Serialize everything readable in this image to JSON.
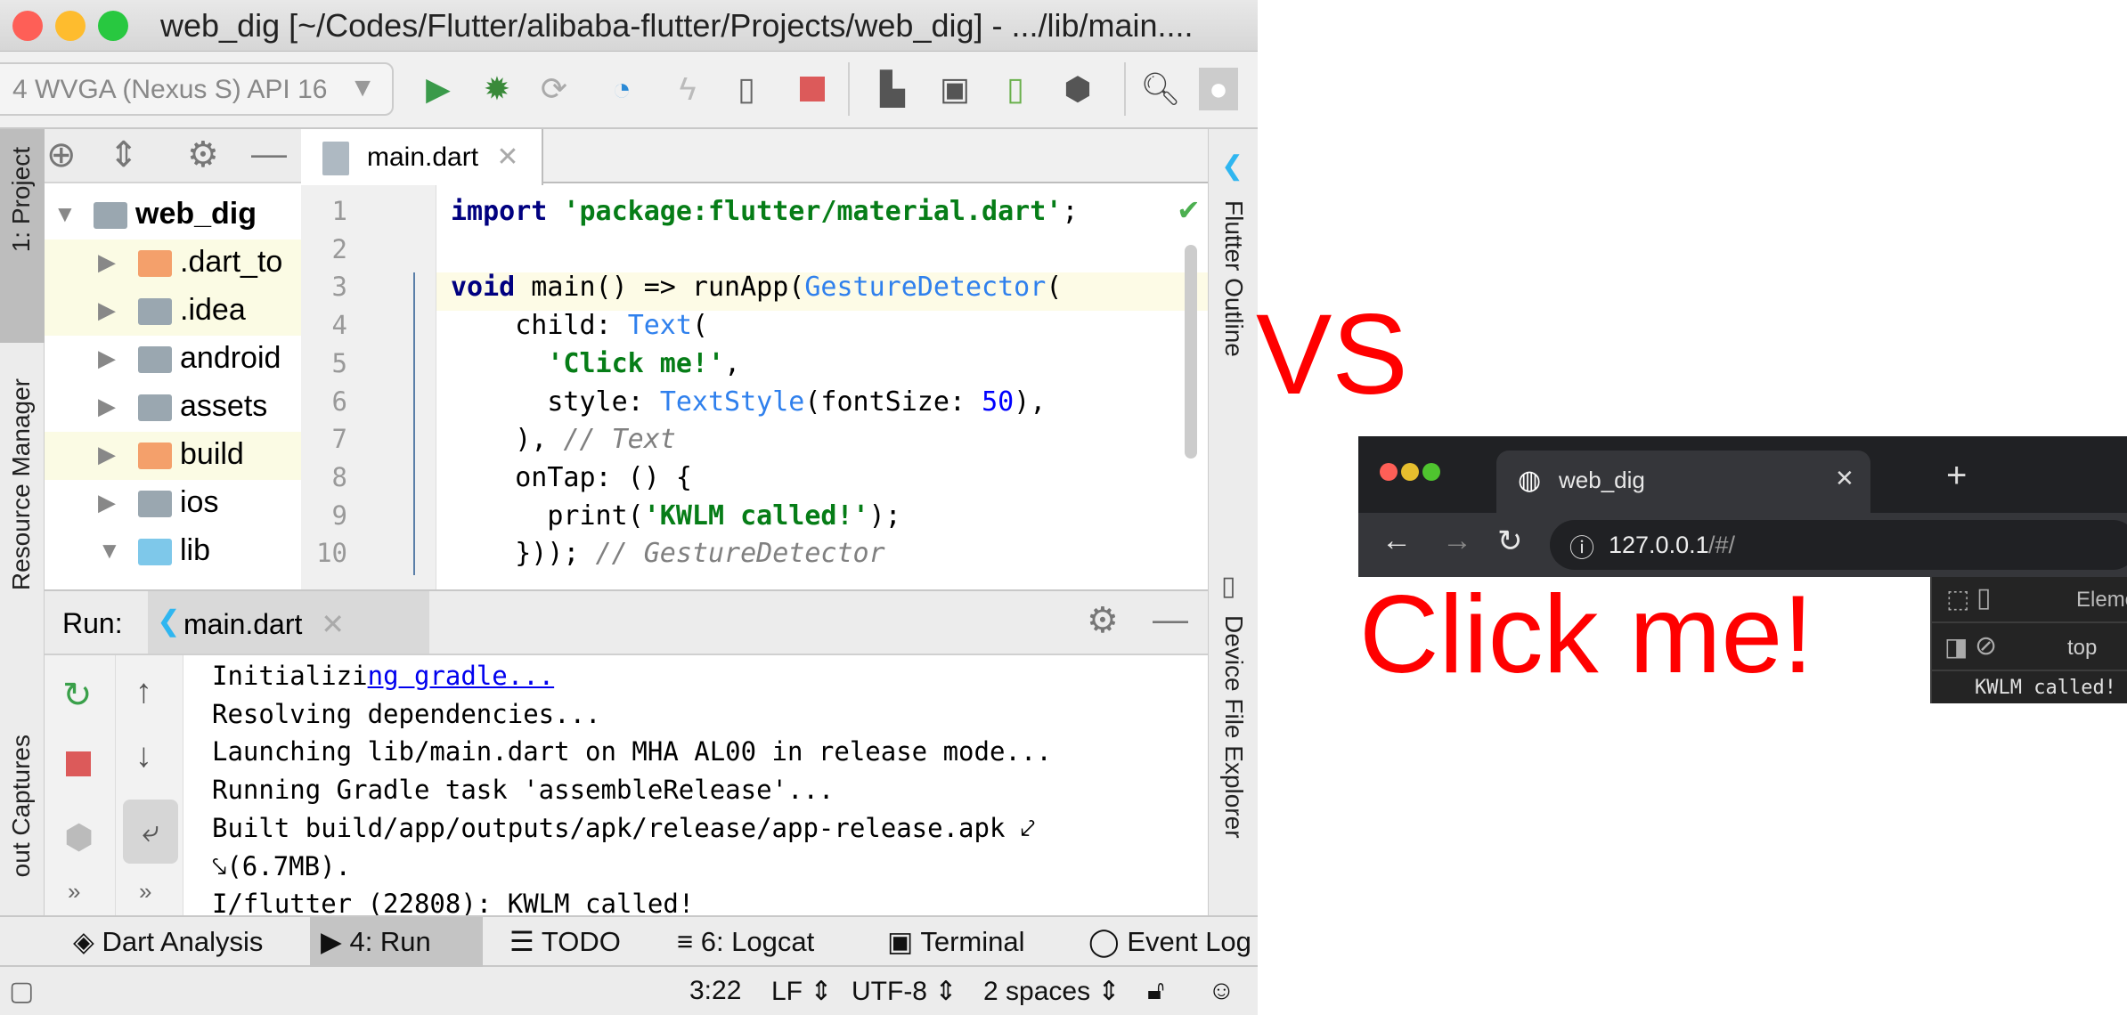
{
  "window": {
    "title": "web_dig [~/Codes/Flutter/alibaba-flutter/Projects/web_dig] - .../lib/main...."
  },
  "toolbar": {
    "device": "4  WVGA (Nexus S) API 16",
    "icons": [
      "run-icon",
      "debug-icon",
      "attach-debugger-icon",
      "profile-icon",
      "hot-reload-icon",
      "flutter-inspector-icon",
      "stop-icon",
      "project-structure-icon",
      "avd-manager-icon",
      "sdk-manager-icon",
      "device-manager-icon",
      "search-icon",
      "user-icon"
    ]
  },
  "left_stripe": {
    "project": "1: Project",
    "resource_manager": "Resource Manager",
    "captures": "out Captures"
  },
  "project": {
    "items": [
      {
        "label": "web_dig",
        "expanded": true,
        "level": 0,
        "bold": true,
        "color": "#9aa7b0",
        "highlight": false
      },
      {
        "label": ".dart_to",
        "expanded": false,
        "level": 1,
        "color": "#f4a06b",
        "highlight": true
      },
      {
        "label": ".idea",
        "expanded": false,
        "level": 1,
        "color": "#9aa7b0",
        "highlight": true
      },
      {
        "label": "android",
        "expanded": false,
        "level": 1,
        "color": "#9aa7b0",
        "highlight": false
      },
      {
        "label": "assets",
        "expanded": false,
        "level": 1,
        "color": "#9aa7b0",
        "highlight": false
      },
      {
        "label": "build",
        "expanded": false,
        "level": 1,
        "color": "#f4a06b",
        "highlight": true
      },
      {
        "label": "ios",
        "expanded": false,
        "level": 1,
        "color": "#9aa7b0",
        "highlight": false
      },
      {
        "label": "lib",
        "expanded": true,
        "level": 1,
        "color": "#7ec8ea",
        "highlight": false
      }
    ]
  },
  "editor": {
    "tab": "main.dart",
    "cursor_line": 3,
    "lines": [
      {
        "n": "1",
        "tokens": [
          [
            "kw",
            "import"
          ],
          [
            "",
            ""
          ],
          [
            "str",
            " 'package:flutter/material.dart'"
          ],
          [
            "",
            ";"
          ]
        ]
      },
      {
        "n": "2",
        "tokens": []
      },
      {
        "n": "3",
        "tokens": [
          [
            "kw",
            "void"
          ],
          [
            "",
            " main() => runApp("
          ],
          [
            "cls",
            "GestureDetector"
          ],
          [
            "",
            "("
          ]
        ]
      },
      {
        "n": "4",
        "tokens": [
          [
            "",
            "    child: "
          ],
          [
            "cls",
            "Text"
          ],
          [
            "",
            "("
          ]
        ]
      },
      {
        "n": "5",
        "tokens": [
          [
            "",
            "      "
          ],
          [
            "str",
            "'Click me!'"
          ],
          [
            "",
            ","
          ]
        ]
      },
      {
        "n": "6",
        "tokens": [
          [
            "",
            "      style: "
          ],
          [
            "cls",
            "TextStyle"
          ],
          [
            "",
            "(fontSize: "
          ],
          [
            "num",
            "50"
          ],
          [
            "",
            "),"
          ]
        ]
      },
      {
        "n": "7",
        "tokens": [
          [
            "",
            "    ), "
          ],
          [
            "cmt",
            "// Text"
          ]
        ]
      },
      {
        "n": "8",
        "tokens": [
          [
            "",
            "    onTap: () {"
          ]
        ]
      },
      {
        "n": "9",
        "tokens": [
          [
            "",
            "      print("
          ],
          [
            "str",
            "'KWLM called!'"
          ],
          [
            "",
            ");"
          ]
        ]
      },
      {
        "n": "10",
        "tokens": [
          [
            "",
            "    })); "
          ],
          [
            "cmt",
            "// GestureDetector"
          ]
        ]
      }
    ]
  },
  "right_stripe": {
    "flutter_outline": "Flutter Outline",
    "device_file_explorer": "Device File Explorer"
  },
  "run": {
    "label": "Run:",
    "tab": "main.dart",
    "output": [
      {
        "text": "Initializi",
        "link": "ng gradle..."
      },
      {
        "text": "Resolving dependencies..."
      },
      {
        "text": "Launching lib/main.dart on MHA AL00 in release mode..."
      },
      {
        "text": "Running Gradle task 'assembleRelease'..."
      },
      {
        "text": "Built build/app/outputs/apk/release/app-release.apk ⤦"
      },
      {
        "text": "⤥(6.7MB)."
      },
      {
        "text": "I/flutter (22808): KWLM called!"
      }
    ]
  },
  "bottom_tools": [
    {
      "label": "Dart Analysis",
      "icon": "dart-analysis-icon",
      "active": false
    },
    {
      "label": "4: Run",
      "icon": "run-icon",
      "active": true
    },
    {
      "label": "TODO",
      "icon": "todo-icon",
      "active": false
    },
    {
      "label": "6: Logcat",
      "icon": "logcat-icon",
      "active": false
    },
    {
      "label": "Terminal",
      "icon": "terminal-icon",
      "active": false
    },
    {
      "label": "Event Log",
      "icon": "event-log-icon",
      "active": false
    }
  ],
  "status": {
    "position": "3:22",
    "line_sep": "LF ⇕",
    "encoding": "UTF-8 ⇕",
    "indent": "2 spaces ⇕"
  },
  "vs": "VS",
  "browser": {
    "tab_title": "web_dig",
    "url_host": "127.0.0.1",
    "url_path": "/#/",
    "page_text": "Click me!",
    "page_color": "#ff0000"
  },
  "devtools": {
    "tab": "Eleme",
    "context": "top",
    "console": "KWLM called!"
  }
}
